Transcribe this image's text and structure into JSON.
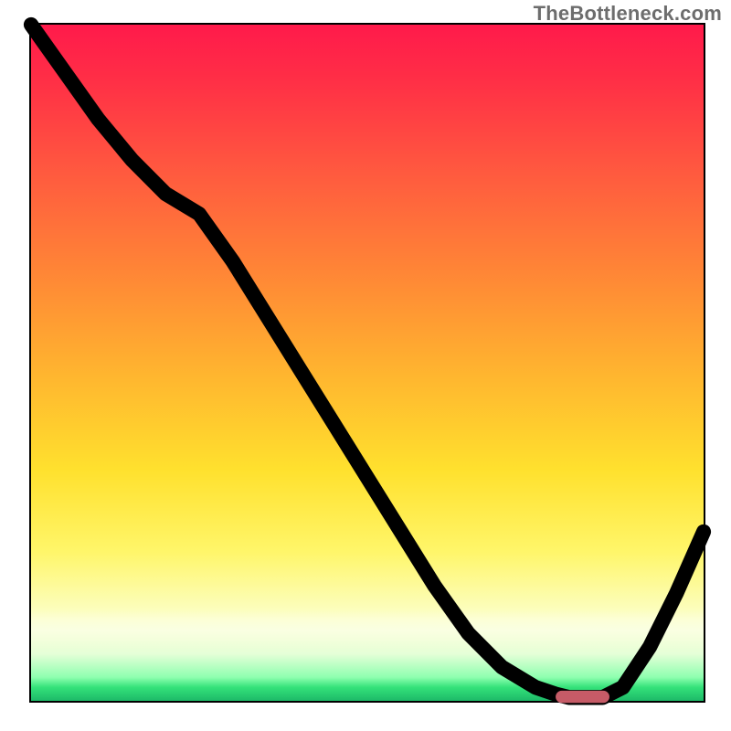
{
  "watermark": "TheBottleneck.com",
  "colors": {
    "gradient_top": "#ff1a4b",
    "gradient_mid": "#ffe12e",
    "gradient_bottom": "#1db968",
    "curve": "#000000",
    "marker": "#c65b67",
    "frame": "#000000"
  },
  "chart_data": {
    "type": "line",
    "title": "",
    "xlabel": "",
    "ylabel": "",
    "xlim": [
      0,
      100
    ],
    "ylim": [
      0,
      100
    ],
    "grid": false,
    "legend": false,
    "x": [
      0,
      5,
      10,
      15,
      20,
      25,
      30,
      35,
      40,
      45,
      50,
      55,
      60,
      65,
      70,
      75,
      78,
      80,
      82,
      85,
      88,
      92,
      96,
      100
    ],
    "y": [
      100,
      93,
      86,
      80,
      75,
      72,
      65,
      57,
      49,
      41,
      33,
      25,
      17,
      10,
      5,
      2,
      1,
      0.5,
      0.5,
      0.5,
      2,
      8,
      16,
      25
    ],
    "annotations": [
      {
        "type": "marker_bar",
        "x_start": 78,
        "x_end": 86,
        "y": 0.5
      }
    ],
    "series": [
      {
        "name": "bottleneck-curve",
        "x_key": "x",
        "y_key": "y"
      }
    ]
  }
}
